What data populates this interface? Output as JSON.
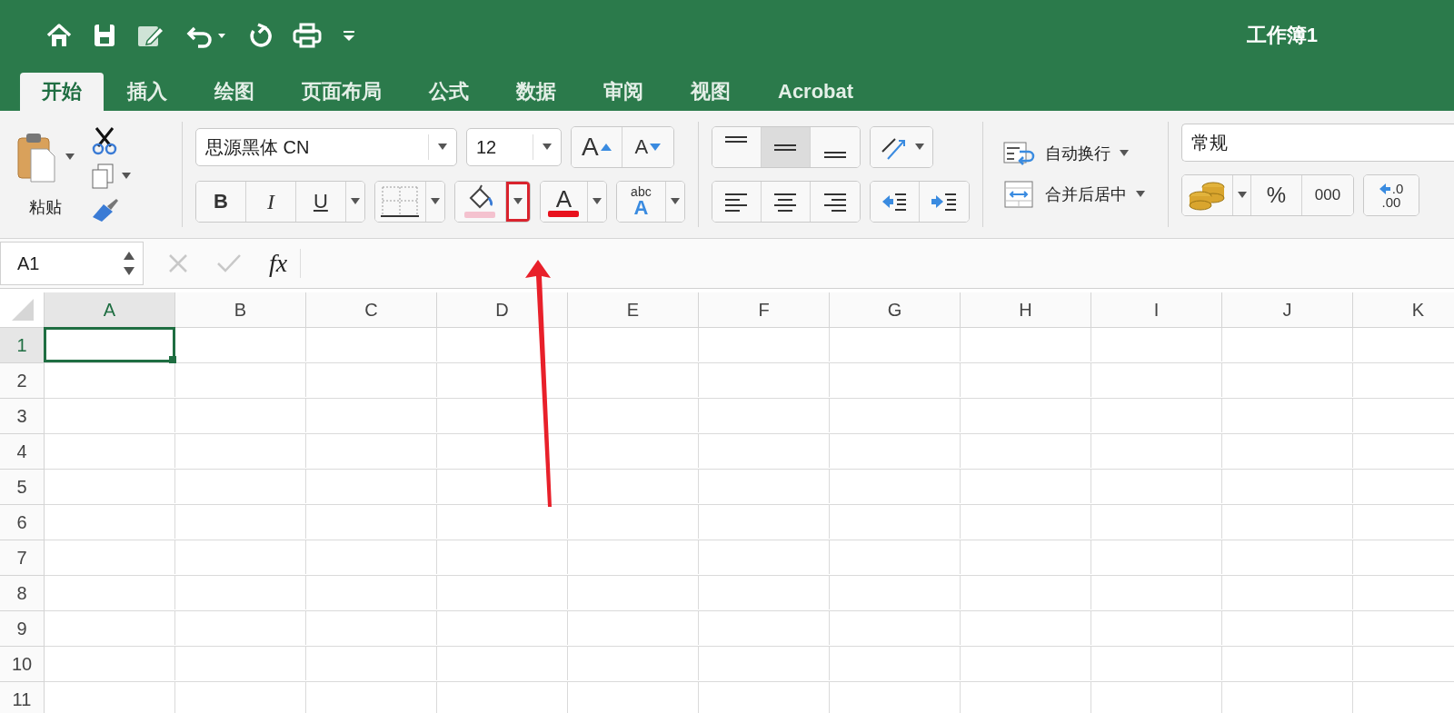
{
  "title_bar": {
    "title": "工作簿1"
  },
  "ribbon_tabs": [
    {
      "label": "开始",
      "selected": true
    },
    {
      "label": "插入",
      "selected": false
    },
    {
      "label": "绘图",
      "selected": false
    },
    {
      "label": "页面布局",
      "selected": false
    },
    {
      "label": "公式",
      "selected": false
    },
    {
      "label": "数据",
      "selected": false
    },
    {
      "label": "审阅",
      "selected": false
    },
    {
      "label": "视图",
      "selected": false
    },
    {
      "label": "Acrobat",
      "selected": false
    }
  ],
  "clipboard": {
    "paste_label": "粘贴"
  },
  "font": {
    "name": "思源黑体 CN",
    "size": "12",
    "grow_label": "A",
    "shrink_label": "A",
    "bold_label": "B",
    "italic_label": "I",
    "underline_label": "U",
    "font_color_label": "A",
    "text_effects_labels": [
      "abc",
      "A"
    ]
  },
  "alignment": {
    "vertical": [
      {
        "selected": false
      },
      {
        "selected": true
      },
      {
        "selected": false
      }
    ]
  },
  "wrap_text": "自动换行",
  "merge_center": "合并后居中",
  "number": {
    "format": "常规",
    "percent": "%",
    "comma": "000",
    "decimal_labels": [
      ".0",
      ".00"
    ]
  },
  "formula_bar": {
    "name_box": "A1",
    "fx_label": "fx"
  },
  "sheet": {
    "columns": [
      {
        "label": "A",
        "selected": true
      },
      {
        "label": "B",
        "selected": false
      },
      {
        "label": "C",
        "selected": false
      },
      {
        "label": "D",
        "selected": false
      },
      {
        "label": "E",
        "selected": false
      },
      {
        "label": "F",
        "selected": false
      },
      {
        "label": "G",
        "selected": false
      },
      {
        "label": "H",
        "selected": false
      },
      {
        "label": "I",
        "selected": false
      },
      {
        "label": "J",
        "selected": false
      },
      {
        "label": "K",
        "selected": false
      }
    ],
    "rows": [
      {
        "label": "1",
        "selected": true
      },
      {
        "label": "2",
        "selected": false
      },
      {
        "label": "3",
        "selected": false
      },
      {
        "label": "4",
        "selected": false
      },
      {
        "label": "5",
        "selected": false
      },
      {
        "label": "6",
        "selected": false
      },
      {
        "label": "7",
        "selected": false
      },
      {
        "label": "8",
        "selected": false
      },
      {
        "label": "9",
        "selected": false
      },
      {
        "label": "10",
        "selected": false
      },
      {
        "label": "11",
        "selected": false
      }
    ]
  }
}
